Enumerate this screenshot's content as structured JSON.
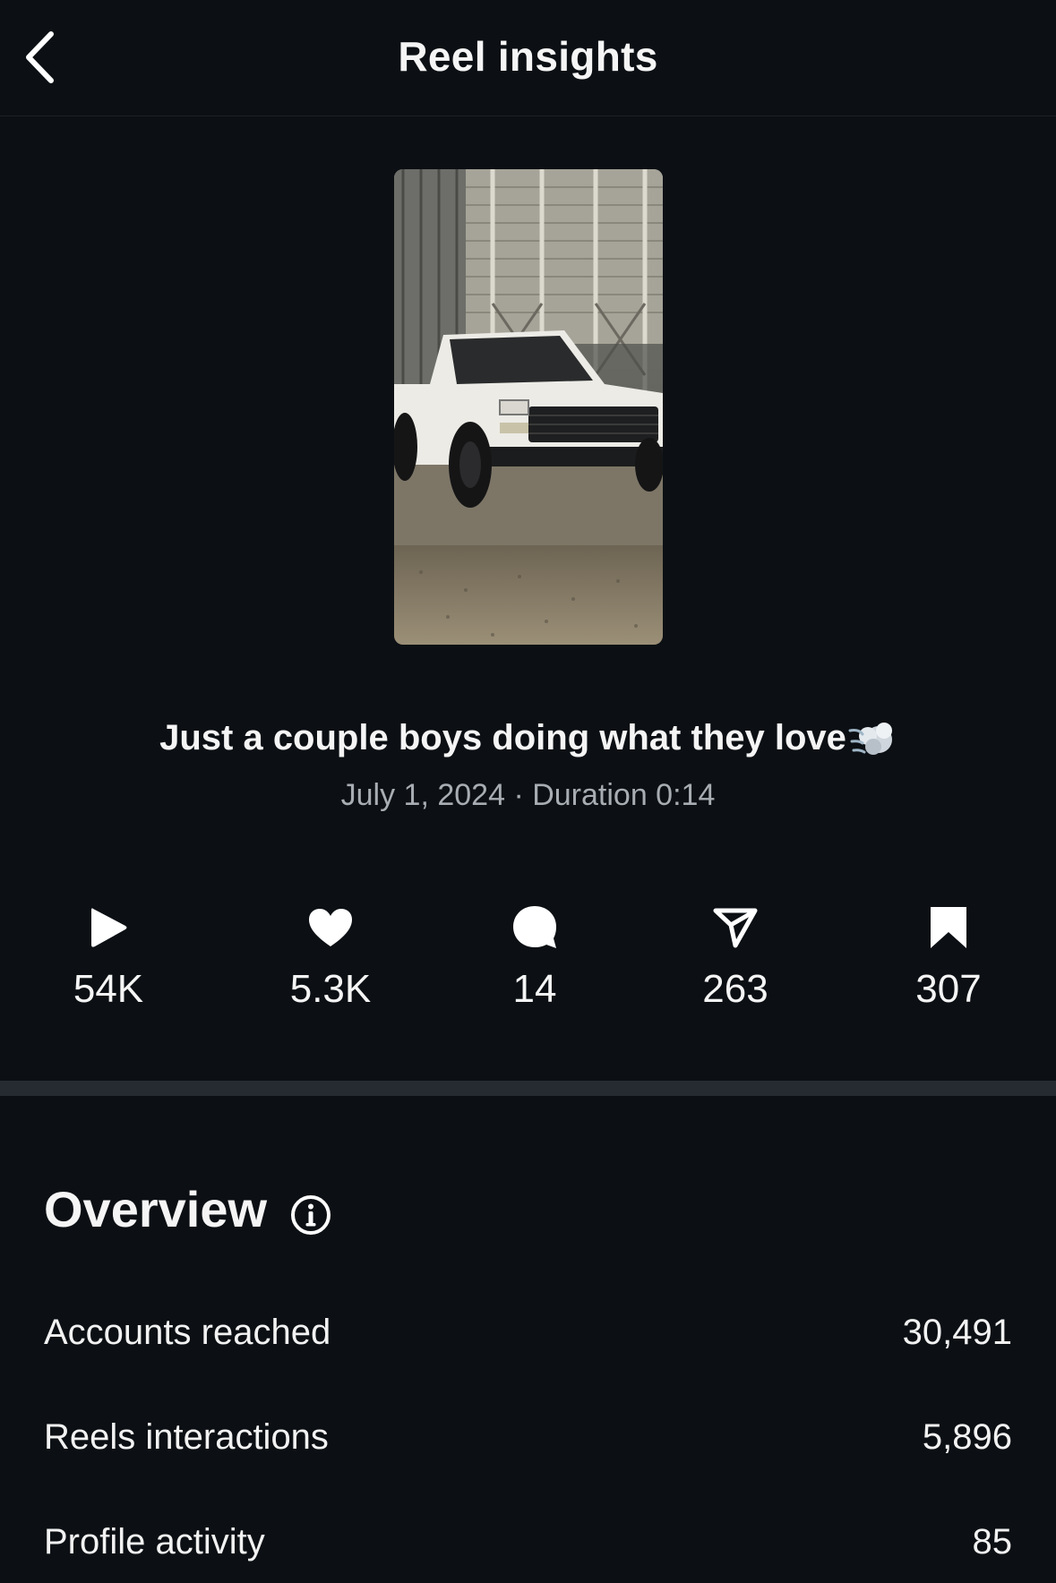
{
  "header": {
    "title": "Reel insights",
    "back_icon": "chevron-left-icon"
  },
  "reel": {
    "caption": "Just a couple boys doing what they love",
    "caption_emoji": "dashing-away-emoji",
    "date": "July 1, 2024",
    "separator": "·",
    "duration_label": "Duration 0:14"
  },
  "stats": [
    {
      "icon": "play-icon",
      "value": "54K"
    },
    {
      "icon": "heart-icon",
      "value": "5.3K"
    },
    {
      "icon": "comment-icon",
      "value": "14"
    },
    {
      "icon": "share-icon",
      "value": "263"
    },
    {
      "icon": "bookmark-icon",
      "value": "307"
    }
  ],
  "overview": {
    "title": "Overview",
    "info_icon": "info-icon",
    "rows": [
      {
        "label": "Accounts reached",
        "value": "30,491"
      },
      {
        "label": "Reels interactions",
        "value": "5,896"
      },
      {
        "label": "Profile activity",
        "value": "85"
      }
    ]
  },
  "colors": {
    "background": "#0c1014",
    "text": "#f5f5f5",
    "muted_text": "#a8adb3",
    "divider": "#262b31"
  }
}
